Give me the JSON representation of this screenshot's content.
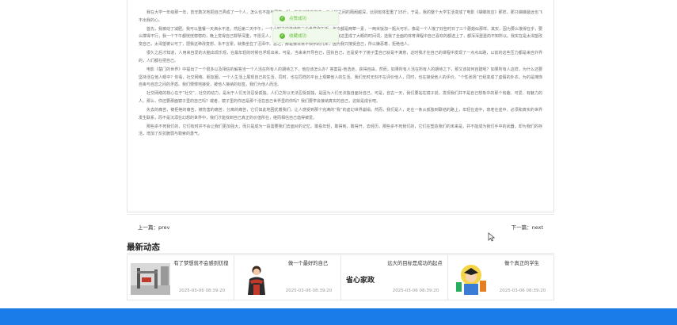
{
  "article": {
    "paragraphs": [
      "我在大学一年级那一年，曾无数次地把自己弄成了一个人，怎么也不能与同学一起，在自己的自卑中，与大家之间的隔阂越深，比别班体型重了15斤。于是，我的整个大学生活变成了电影《蝴蝶效应》那样，那只蝴蝶最远也飞不出我的心。",
      "首先，我被动了减肥。我可以整餐一天滴水不进，然后第二天中午，一个小时之内连续吃三个食堂炸午饭，每次都是两荤一素，一两米饭加一瓶大可乐，像是一个人饿了好些时日了三个蘑菇似那样。其实，因为要么饿得在乎，要么撑得不行，我一个下午都恍恍惚惚的，晚上觉得自己罪孽深重，不愿见人，便拉起了被子。其三，选课的念头在我这里成了大概的时间词，选我了全面的体育课程中自己喜欢的都选上了，都浑浑噩噩的不知所以。我实在是太渴望改变自己，太渴望被认可了，把我这种改变想，永不言累，就像坐在了沼泽中。总之，那是我非常不快乐的几年，因为我只接受自己，所以嫌恶着，拒绝他人。",
      "很久之后才知道，人用来自爱的大脑出现乐观，在最年轻的时候也浮现出来，可是，当来来开导自己，固执自己，还是受不了镜子里自己就是不满意，这时我才在自己的课程中发现了一点点出路，以前的这些压力都是来自外界的，人们都在把自己。",
      "电影《楚门的世界》中提出了一个很多以及相信的解答当一个人活在所有人的期待之下，他应该怎么办？答案是-他选走，获得自由。然而，如果所有人活在所有人的期待之下，那又该如何自建呢？如果所有人这样，为什么还要坚持活在他人眼中？你看，社交网络、朋友圈，一个人生活上展现自己的生活，同时，也在同样的平台上观察他人的生活。我们无时无刻不在评价他人，同时，也在接受他人的评价。“个性张扬”已经变成了虚假的外衣，为的是掩饰自卑与自恋之间的矛盾。我们慢慢地接受，被他人接纳的标签，我们为他人而活。",
      "社交网络的核心在于“社交”，社交的动力，是出于人们无法忍受孤独。人们之所以无法忍受孤独，是因为人们无法独自面对自己。可是，自古一天，我们要站在镜子前，发现我们并不是自己想象中的那个有趣、可爱、有魅力的人。那么，你还要那面镜子里的自己吗？或者，镜子里的你还是那个活在自己世界里的你吗？我们要学会接纳真实的自己，这就是成长吧。",
      "失去的痛苦，被拒绝的痛苦，被伤害的痛苦，分离的痛苦，它们如此地困扰着我们，让人感受到那个完满的“我”的虚幻世界崩塌。然而，我们是人，走在一条从孤独到联结的路上，年轻在途中，衰老在途中。必须和真实的世界发生联系，而不是沉溺在幻想的世界中，我们才能找到自己真正的价值所在，继而相信自己值得被爱。",
      "那些杀不死我们的，它们有时并不会让我们更加强大，而只是成为一段需要我们去面对的记忆。敢看年轻，敢得到，敢得开，去经历。那些杀不死我们的，它们在塑造我们的未来是，并不能成为我们手中的武器，却为我们的存活，增加了反抗脆弱与勒索的勇气。"
    ]
  },
  "toasts": [
    {
      "message": "点赞成功"
    },
    {
      "message": "收藏成功"
    }
  ],
  "pager": {
    "prev": "上一篇：prev",
    "next": "下一篇：next"
  },
  "latest": {
    "title": "最新动态",
    "items": [
      {
        "title": "有了梦想就不会感到彷徨",
        "date": "2025-03-06 08:39:20",
        "thumb": "gym-machine"
      },
      {
        "title": "做一个最好的自己",
        "date": "2025-03-06 08:39:20",
        "thumb": "woman-portrait"
      },
      {
        "title": "远大的目标是成功的起点",
        "date": "2025-03-06 08:39:20",
        "thumb": "text-graphic",
        "overlay": "省心家政"
      },
      {
        "title": "做个真正的学生",
        "date": "2025-03-06 08:39:20",
        "thumb": "cartoon-student"
      }
    ]
  },
  "colors": {
    "footer": "#1a7ce8",
    "toast_text": "#67c23a",
    "toast_bg": "#f0f9eb"
  }
}
